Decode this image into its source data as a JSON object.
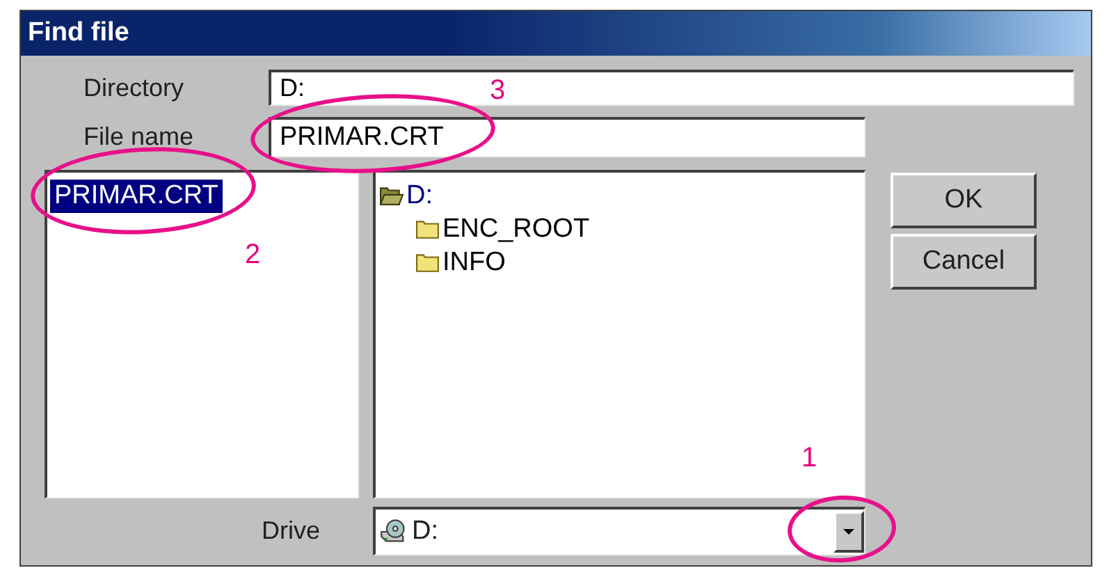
{
  "window": {
    "title": "Find file"
  },
  "directory": {
    "label": "Directory",
    "value": "D:"
  },
  "file_name": {
    "label": "File name",
    "value": "PRIMAR.CRT"
  },
  "files": [
    {
      "name": "PRIMAR.CRT",
      "selected": true
    }
  ],
  "folders": [
    {
      "name": "D:",
      "expanded": true,
      "children": [
        {
          "name": "ENC_ROOT",
          "expanded": false
        },
        {
          "name": "INFO",
          "expanded": false
        }
      ]
    }
  ],
  "buttons": [
    "OK",
    "Cancel"
  ],
  "drive": {
    "label": "Drive",
    "value": "D:"
  },
  "callouts": [
    {
      "label": "1"
    },
    {
      "label": "2"
    },
    {
      "label": "3"
    }
  ]
}
